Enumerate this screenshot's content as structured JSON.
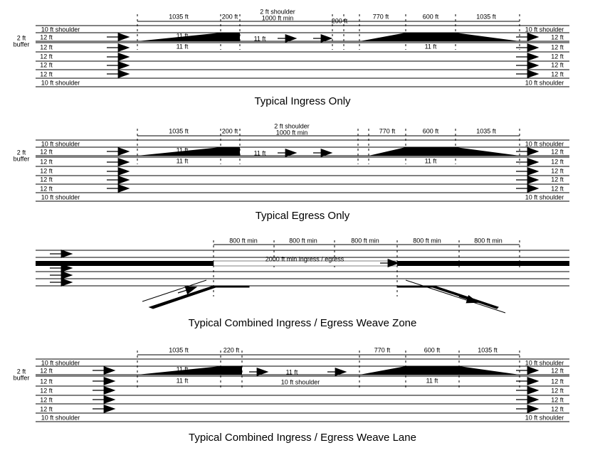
{
  "diagram1": {
    "title": "Typical Ingress Only",
    "top_shoulder_note": "2 ft shoulder",
    "top_min": "1000 ft min",
    "dims": [
      "1035 ft",
      "200 ft",
      "200 ft",
      "770 ft",
      "600 ft",
      "1035 ft"
    ],
    "shoulder_left": "10 ft shoulder",
    "shoulder_right": "10 ft shoulder",
    "shoulder_bot_left": "10 ft shoulder",
    "shoulder_bot_right": "10 ft shoulder",
    "buffer": "2 ft\nbuffer",
    "lane_w": "12 ft",
    "lane11": "11 ft"
  },
  "diagram2": {
    "title": "Typical Egress Only",
    "top_shoulder_note": "2 ft shoulder",
    "top_min": "1000 ft min",
    "dims": [
      "1035 ft",
      "200 ft",
      "770 ft",
      "600 ft",
      "1035 ft"
    ],
    "shoulder_left": "10 ft shoulder",
    "shoulder_right": "10 ft shoulder",
    "shoulder_bot_left": "10 ft shoulder",
    "shoulder_bot_right": "10 ft shoulder",
    "buffer": "2 ft\nbuffer",
    "lane_w": "12 ft",
    "lane11": "11 ft"
  },
  "diagram3": {
    "title": "Typical Combined Ingress / Egress Weave Zone",
    "dims": [
      "800 ft min",
      "800 ft min",
      "800 ft min",
      "800 ft min",
      "800 ft min"
    ],
    "zone_label": "2000 ft min ingress / egress"
  },
  "diagram4": {
    "title": "Typical Combined Ingress / Egress Weave Lane",
    "dims": [
      "1035 ft",
      "220 ft",
      "770 ft",
      "600 ft",
      "1035 ft"
    ],
    "shoulder_left": "10 ft shoulder",
    "shoulder_right": "10 ft shoulder",
    "shoulder_bot_left": "10 ft shoulder",
    "shoulder_bot_right": "10 ft shoulder",
    "buffer": "2 ft\nbuffer",
    "lane_w": "12 ft",
    "lane11": "11 ft",
    "center_note": "10 ft shoulder"
  }
}
